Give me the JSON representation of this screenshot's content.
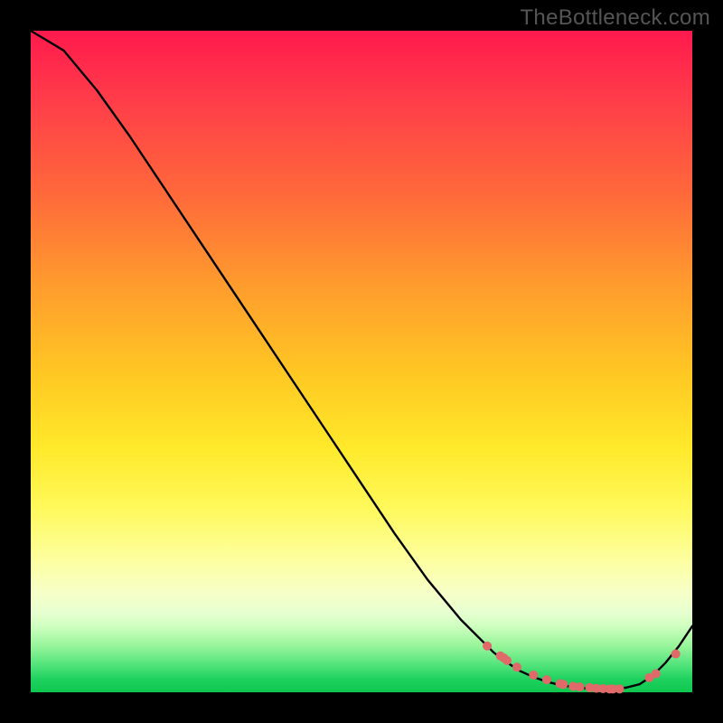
{
  "attribution": "TheBottleneck.com",
  "chart_data": {
    "type": "line",
    "title": "",
    "xlabel": "",
    "ylabel": "",
    "ylim": [
      0,
      100
    ],
    "x": [
      0.0,
      0.05,
      0.1,
      0.15,
      0.2,
      0.25,
      0.3,
      0.35,
      0.4,
      0.45,
      0.5,
      0.55,
      0.6,
      0.65,
      0.7,
      0.72,
      0.74,
      0.76,
      0.78,
      0.8,
      0.82,
      0.84,
      0.86,
      0.88,
      0.9,
      0.92,
      0.94,
      0.96,
      0.98,
      1.0
    ],
    "series": [
      {
        "name": "curve",
        "values": [
          100.0,
          97.0,
          91.0,
          84.0,
          76.5,
          69.0,
          61.5,
          54.0,
          46.5,
          39.0,
          31.5,
          24.0,
          17.0,
          11.0,
          6.0,
          4.5,
          3.2,
          2.3,
          1.6,
          1.1,
          0.8,
          0.6,
          0.5,
          0.5,
          0.7,
          1.2,
          2.5,
          4.5,
          7.0,
          10.0
        ]
      }
    ],
    "markers": {
      "name": "dots",
      "color": "#e06a6a",
      "x": [
        0.69,
        0.71,
        0.715,
        0.72,
        0.735,
        0.76,
        0.78,
        0.8,
        0.805,
        0.82,
        0.83,
        0.845,
        0.855,
        0.865,
        0.875,
        0.88,
        0.89,
        0.935,
        0.945,
        0.975
      ],
      "values": [
        7.0,
        5.5,
        5.2,
        4.8,
        3.8,
        2.6,
        1.9,
        1.3,
        1.2,
        0.9,
        0.8,
        0.7,
        0.6,
        0.55,
        0.5,
        0.5,
        0.5,
        2.2,
        2.8,
        5.8
      ]
    }
  }
}
